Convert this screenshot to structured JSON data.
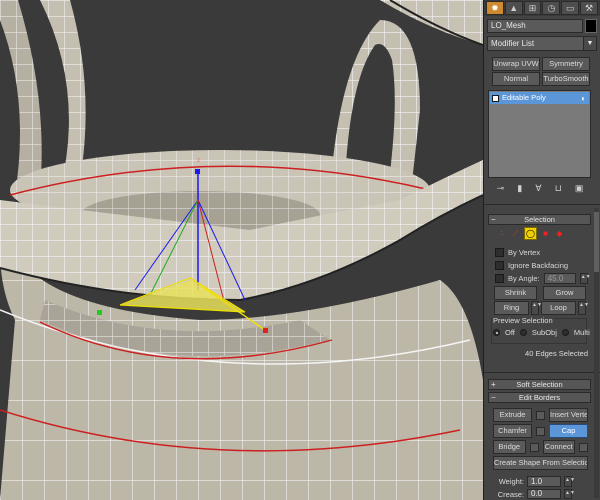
{
  "colors": {
    "accent_orange": "#cf8a30",
    "selection_blue": "#5b96d8",
    "panel_bg": "#444444",
    "mesh_fill": "#bdb7a8",
    "selected_edge_red": "#cc2020",
    "highlight_yellow": "#f0e000"
  },
  "command_panel": {
    "tabs": [
      {
        "icon": "sun-icon",
        "glyph": "✹"
      },
      {
        "icon": "shape-icon",
        "glyph": "▲"
      },
      {
        "icon": "hierarchy-icon",
        "glyph": "⊞"
      },
      {
        "icon": "motion-icon",
        "glyph": "◷"
      },
      {
        "icon": "display-icon",
        "glyph": "▭"
      },
      {
        "icon": "utilities-icon",
        "glyph": "⚒"
      }
    ],
    "object_name": "LO_Mesh",
    "modifier_list_label": "Modifier List",
    "modifier_buttons": [
      [
        "Unwrap UVW",
        "Symmetry"
      ],
      [
        "Normal",
        "TurboSmooth"
      ]
    ],
    "stack_item": "Editable Poly"
  },
  "selection": {
    "title": "Selection",
    "by_vertex": "By Vertex",
    "ignore_backfacing": "Ignore Backfacing",
    "by_angle": "By Angle:",
    "by_angle_value": "45.0",
    "shrink": "Shrink",
    "grow": "Grow",
    "ring": "Ring",
    "loop": "Loop",
    "preview_title": "Preview Selection",
    "preview_off": "Off",
    "preview_subobj": "SubObj",
    "preview_multi": "Multi",
    "status": "40 Edges Selected"
  },
  "soft_selection": {
    "title": "Soft Selection"
  },
  "edit_borders": {
    "title": "Edit Borders",
    "extrude": "Extrude",
    "insert_vertex": "Insert Vertex",
    "chamfer": "Chamfer",
    "cap": "Cap",
    "bridge": "Bridge",
    "connect": "Connect",
    "create_shape": "Create Shape From Selection",
    "weight_label": "Weight:",
    "weight_value": "1.0",
    "crease_label": "Crease:",
    "crease_value": "0.0"
  }
}
